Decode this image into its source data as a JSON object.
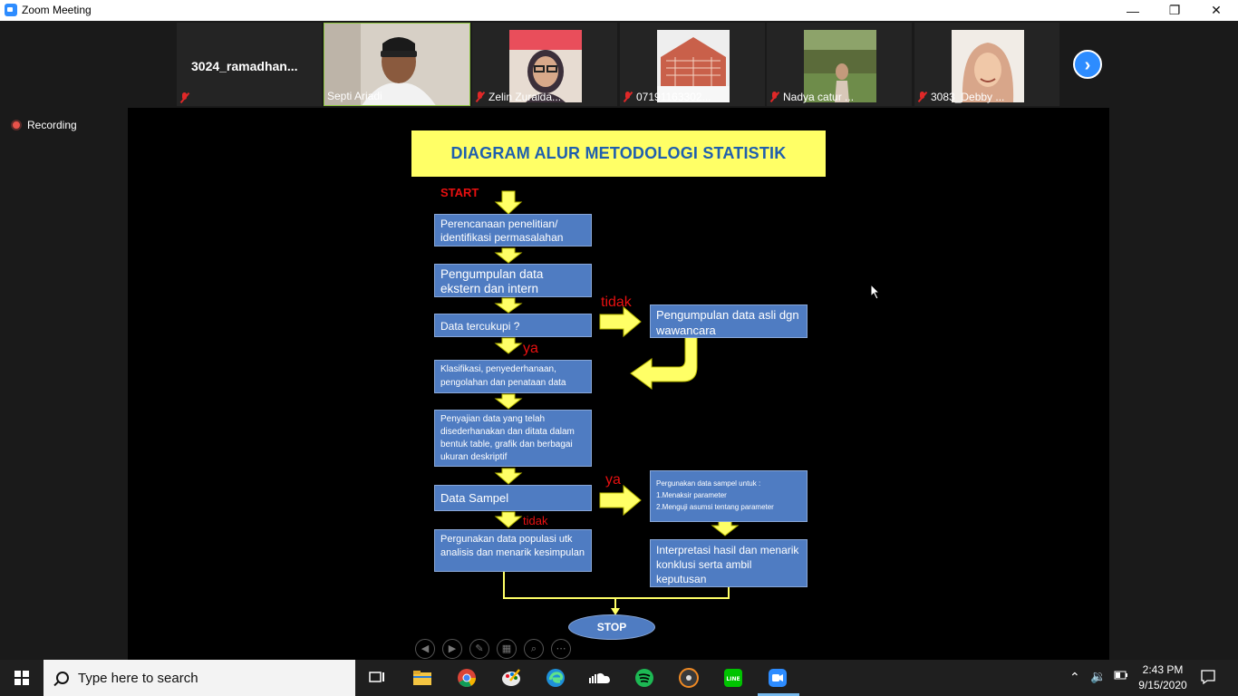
{
  "window": {
    "title": "Zoom Meeting",
    "minimize_glyph": "—",
    "restore_glyph": "❐",
    "close_glyph": "✕"
  },
  "participants": [
    {
      "name": "3024_ramadhan...",
      "muted": true
    },
    {
      "name": "Septi Ariadi",
      "muted": false,
      "active_speaker": true
    },
    {
      "name": "Zelin Zuraida...",
      "muted": true
    },
    {
      "name": "07191163302...",
      "muted": true
    },
    {
      "name": "Nadya catur ...",
      "muted": true
    },
    {
      "name": "3083_Debby ...",
      "muted": true
    }
  ],
  "next_page_icon": "chevron-right-icon",
  "recording_label": "Recording",
  "slide": {
    "title": "DIAGRAM ALUR METODOLOGI STATISTIK",
    "start": "START",
    "step1": "Perencanaan penelitian/ identifikasi permasalahan",
    "step2": "Pengumpulan data ekstern dan intern",
    "step3": "Data tercukupi ?",
    "step3_no": "tidak",
    "step3_yes": "ya",
    "alt1": "Pengumpulan data asli dgn wawancara",
    "step4": "Klasifikasi, penyederhanaan, pengolahan dan penataan data",
    "step5": "Penyajian data yang telah disederhanakan dan ditata dalam bentuk table, grafik dan berbagai ukuran deskriptif",
    "step6": "Data Sampel",
    "step6_yes": "ya",
    "step6_no": "tidak",
    "sample_use": "Pergunakan data sampel untuk :\n1.Menaksir parameter\n2.Menguji asumsi tentang parameter",
    "population_use": "Pergunakan data populasi utk analisis dan menarik kesimpulan",
    "interpret": "Interpretasi hasil dan menarik konklusi serta ambil keputusan",
    "stop": "STOP"
  },
  "colors": {
    "box_blue": "#4f7cc2",
    "title_yellow": "#ffff66",
    "arrow_yellow": "#ffff66",
    "label_red": "#e81010",
    "zoom_blue": "#2d8cff"
  },
  "taskbar": {
    "search_placeholder": "Type here to search",
    "time": "2:43 PM",
    "date": "9/15/2020",
    "apps": [
      "task-view",
      "file-explorer",
      "chrome",
      "paint",
      "edge",
      "soundcloud",
      "spotify",
      "media-player",
      "line",
      "zoom"
    ]
  }
}
